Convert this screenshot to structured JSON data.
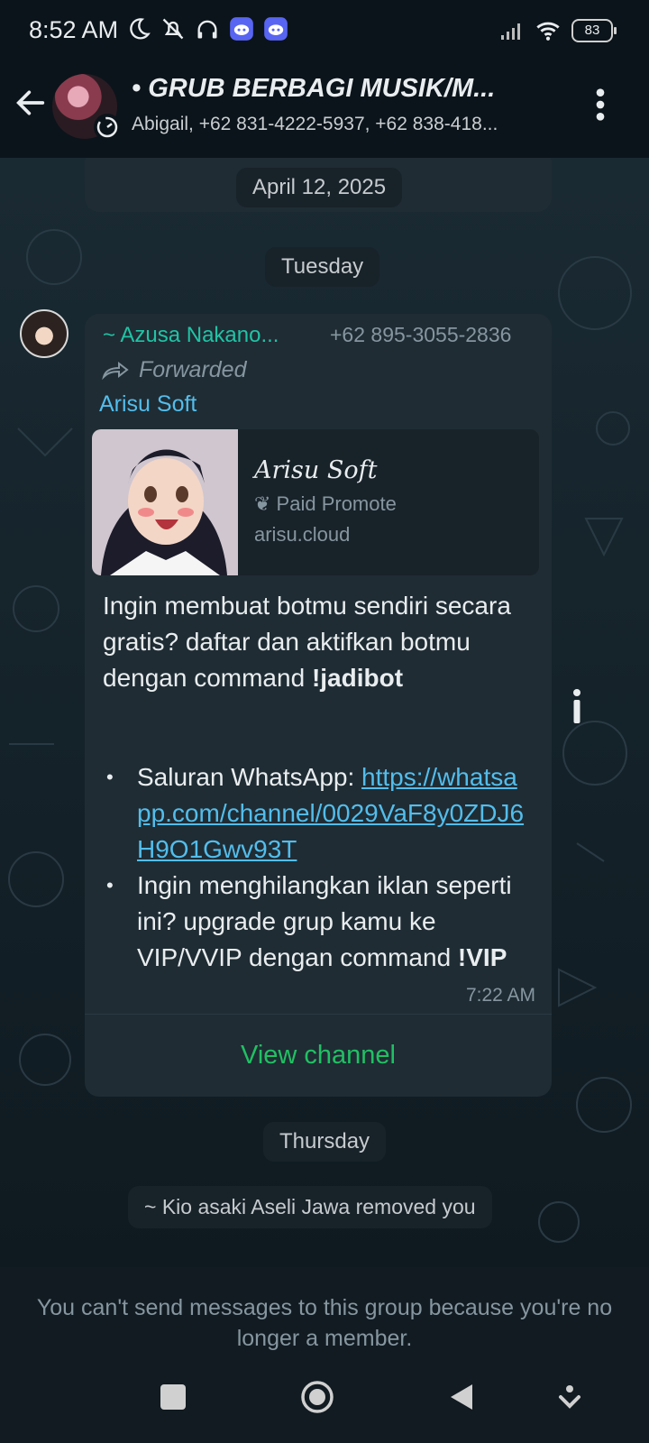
{
  "status_bar": {
    "time": "8:52 AM",
    "battery": "83"
  },
  "header": {
    "title": "• GRUB BERBAGI MUSIK/M...",
    "members": "Abigail, +62 831-4222-5937, +62 838-418..."
  },
  "chat": {
    "date_chip_1": "April 12, 2025",
    "date_chip_2": "Tuesday",
    "message": {
      "sender": "~ Azusa Nakano...",
      "phone": "+62 895-3055-2836",
      "forwarded": "Forwarded",
      "channel": "Arisu Soft",
      "preview": {
        "title": "Arisu Soft",
        "subtitle": "Paid Promote",
        "domain": "arisu.cloud"
      },
      "body_text": "Ingin membuat botmu sendiri secara gratis? daftar dan aktifkan botmu dengan command ",
      "body_command": "!jadibot",
      "bullet_1_text": "Saluran WhatsApp: ",
      "bullet_1_link": "https://whatsapp.com/channel/0029VaF8y0ZDJ6H9O1Gwv93T",
      "bullet_2_text": "Ingin menghilangkan iklan seperti ini? upgrade grup kamu ke VIP/VVIP dengan command ",
      "bullet_2_command": "!VIP",
      "time": "7:22 AM",
      "view_channel": "View channel"
    },
    "date_chip_3": "Thursday",
    "system_message": "~ Kio asaki Aseli Jawa removed you"
  },
  "footer": {
    "notice": "You can't send messages to this group because you're no longer a member."
  },
  "icons": [
    "back-arrow-icon",
    "kebab-menu-icon",
    "forward-icon",
    "info-icon",
    "moon-icon",
    "mute-icon",
    "headphones-icon",
    "discord-icon",
    "signal-icon",
    "wifi-icon"
  ],
  "colors": {
    "accent_green": "#21c063",
    "sender_teal": "#21c3a5",
    "link_blue": "#53bdeb",
    "bubble": "#1f2c34"
  }
}
